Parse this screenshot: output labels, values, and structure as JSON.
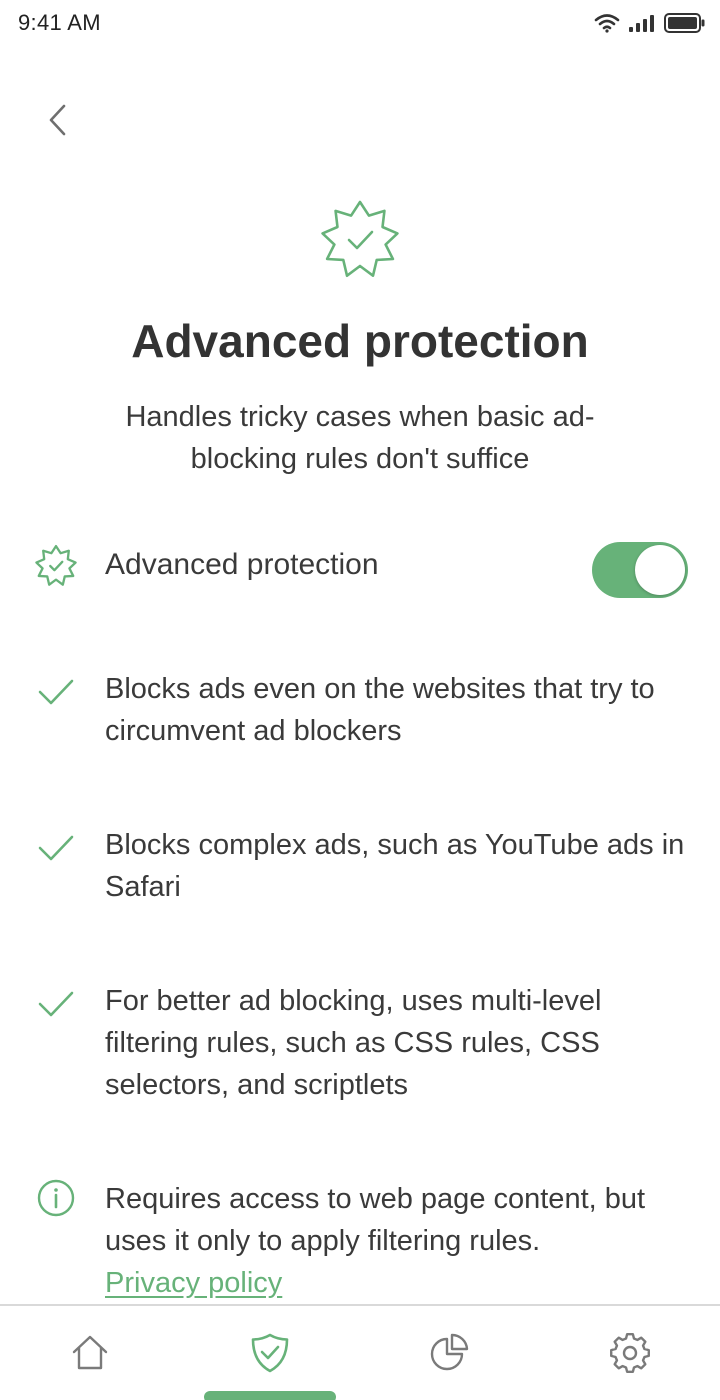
{
  "status_bar": {
    "time": "9:41 AM"
  },
  "nav": {
    "back_icon": "chevron-left-icon"
  },
  "hero": {
    "icon": "starburst-check-icon"
  },
  "title": "Advanced protection",
  "subtitle": "Handles tricky cases when basic ad-blocking rules don't suffice",
  "toggle_row": {
    "label": "Advanced protection",
    "enabled": true,
    "icon": "starburst-check-icon"
  },
  "features": [
    {
      "icon": "checkmark-icon",
      "text": "Blocks ads even on the websites that try to circumvent ad blockers"
    },
    {
      "icon": "checkmark-icon",
      "text": "Blocks complex ads, such as YouTube ads in Safari"
    },
    {
      "icon": "checkmark-icon",
      "text": "For better ad blocking, uses multi-level filtering rules, such as CSS rules, CSS selectors, and scriptlets"
    }
  ],
  "info": {
    "icon": "info-icon",
    "text": "Requires access to web page content, but uses it only to apply filtering rules.",
    "link_label": "Privacy policy"
  },
  "tab_bar": {
    "tabs": [
      {
        "name": "home",
        "icon": "home-icon",
        "active": false
      },
      {
        "name": "protection",
        "icon": "shield-check-icon",
        "active": true
      },
      {
        "name": "statistics",
        "icon": "pie-chart-icon",
        "active": false
      },
      {
        "name": "settings",
        "icon": "gear-icon",
        "active": false
      }
    ]
  },
  "colors": {
    "accent": "#67b279",
    "text": "#3a3a3a",
    "title": "#333333",
    "icon_gray": "#7a7a7a",
    "divider": "#d9d9d9"
  }
}
